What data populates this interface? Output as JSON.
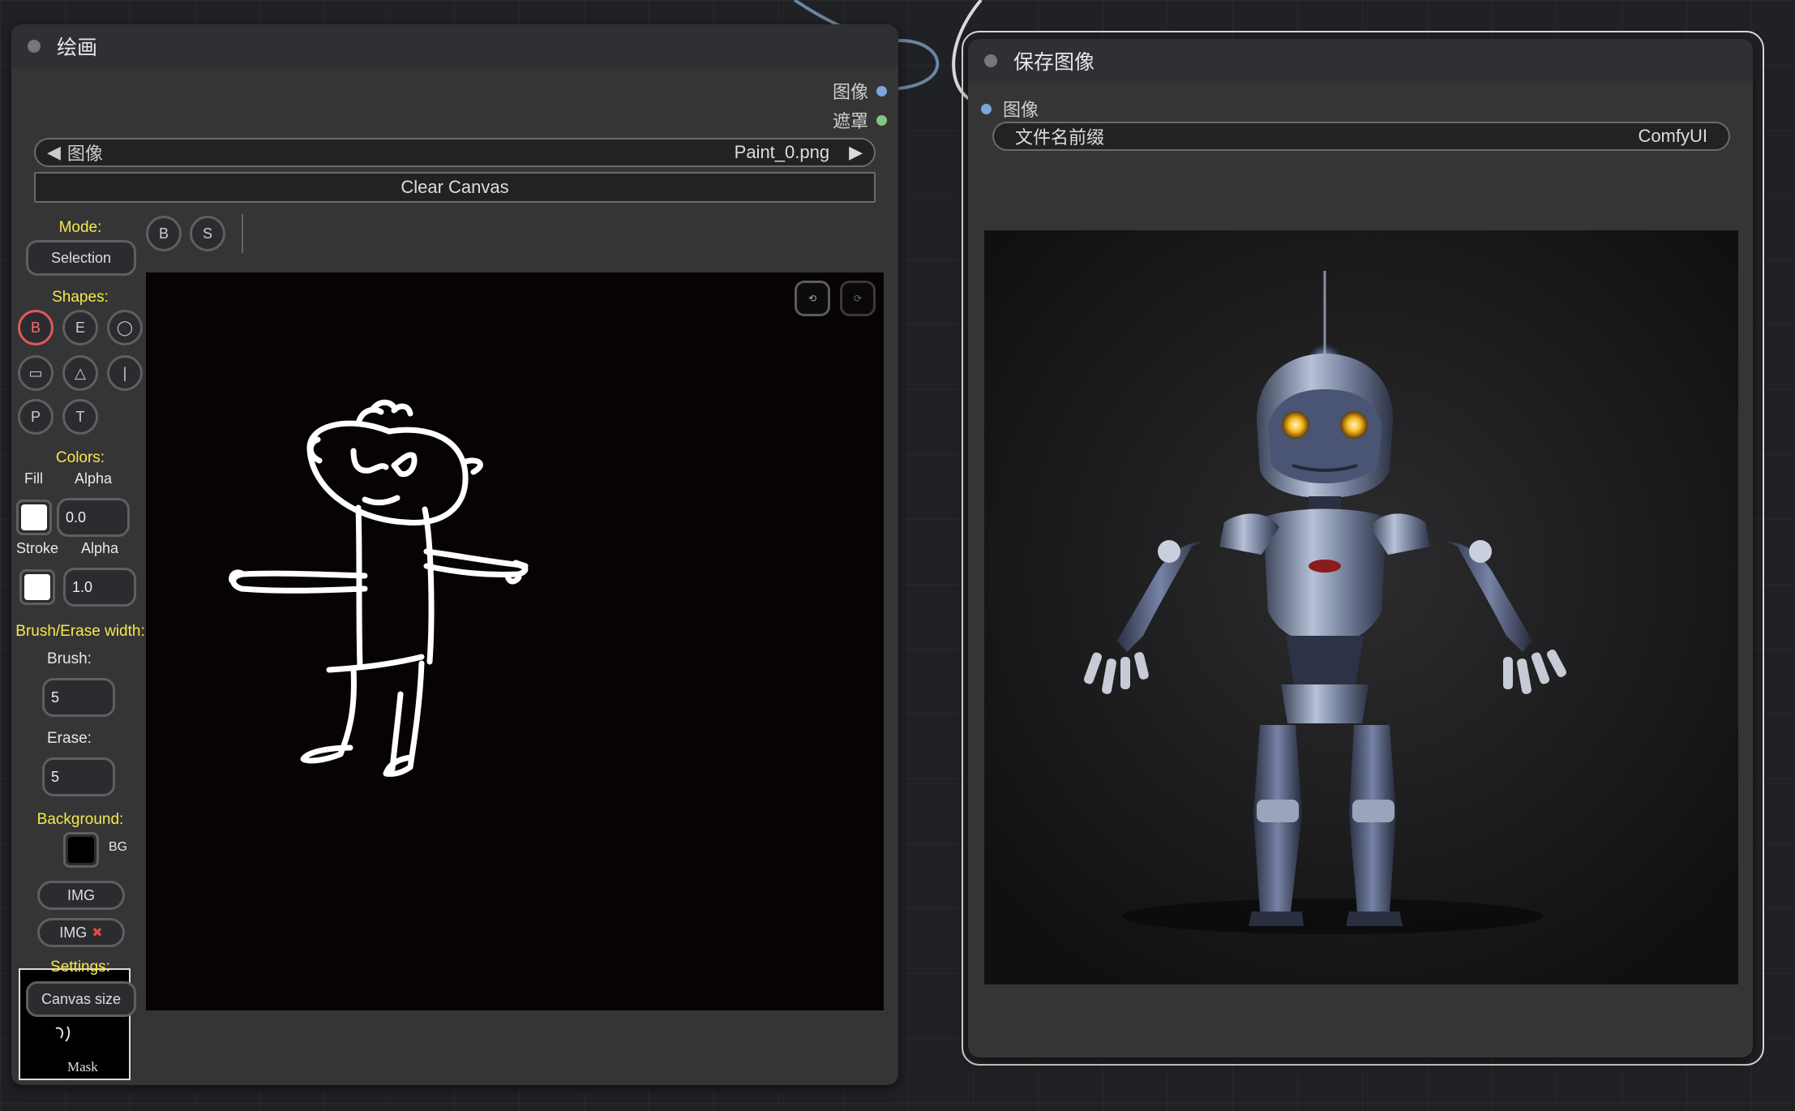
{
  "canvas_bg": "#202124",
  "painter_node": {
    "title": "绘画",
    "outputs": [
      {
        "label": "图像",
        "dot_color": "#7ea4d8"
      },
      {
        "label": "遮罩",
        "dot_color": "#81c784"
      }
    ],
    "image_widget": {
      "label": "图像",
      "value": "Paint_0.png",
      "left_arrow": "◀",
      "right_arrow": "▶"
    },
    "clear_button": "Clear Canvas",
    "toolbar": {
      "mode_buttons": [
        "B",
        "S"
      ]
    },
    "sidebar": {
      "mode_label": "Mode:",
      "mode_value": "Selection",
      "shapes_label": "Shapes:",
      "shapes": [
        {
          "label": "B",
          "icon": "brush-icon",
          "active": true
        },
        {
          "label": "E",
          "icon": "eraser-icon",
          "active": false
        },
        {
          "label": "◯",
          "icon": "circle-icon",
          "active": false
        },
        {
          "label": "▭",
          "icon": "rectangle-icon",
          "active": false
        },
        {
          "label": "△",
          "icon": "triangle-icon",
          "active": false
        },
        {
          "label": "|",
          "icon": "line-icon",
          "active": false
        },
        {
          "label": "P",
          "icon": "polygon-icon",
          "active": false
        },
        {
          "label": "T",
          "icon": "text-icon",
          "active": false
        }
      ],
      "colors_label": "Colors:",
      "fill_label": "Fill",
      "fill_alpha_label": "Alpha",
      "fill_color": "#ffffff",
      "fill_alpha": "0.0",
      "stroke_label": "Stroke",
      "stroke_alpha_label": "Alpha",
      "stroke_color": "#ffffff",
      "stroke_alpha": "1.0",
      "brush_erase_label": "Brush/Erase width:",
      "brush_label": "Brush:",
      "brush_value": "5",
      "erase_label": "Erase:",
      "erase_value": "5",
      "background_label": "Background:",
      "bg_color": "#000000",
      "bg_text": "BG",
      "img_button": "IMG",
      "img_remove_button": "IMG",
      "img_remove_mark": "✖",
      "settings_label": "Settings:",
      "canvas_size_button": "Canvas size",
      "mask_label": "Mask"
    },
    "history": {
      "undo_icon": "⟲",
      "redo_icon": "⟳"
    }
  },
  "save_node": {
    "title": "保存图像",
    "input_label": "图像",
    "prefix_label": "文件名前缀",
    "prefix_value": "ComfyUI",
    "preview_alt": "robot-preview-image"
  }
}
